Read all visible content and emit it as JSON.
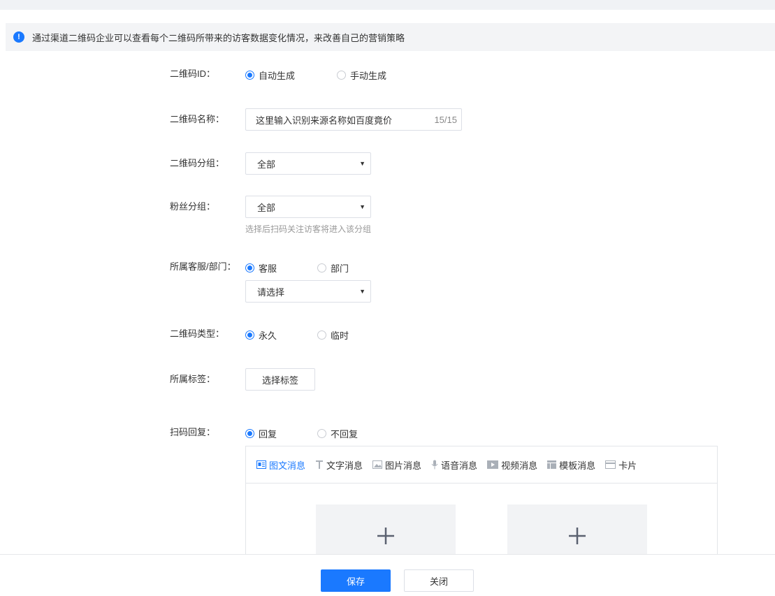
{
  "notice": {
    "text": "通过渠道二维码企业可以查看每个二维码所带来的访客数据变化情况，来改善自己的营销策略"
  },
  "form": {
    "qr_id": {
      "label": "二维码ID：",
      "options": [
        "自动生成",
        "手动生成"
      ],
      "selected": "自动生成"
    },
    "qr_name": {
      "label": "二维码名称：",
      "value": "这里输入识别来源名称如百度竟价",
      "counter": "15/15"
    },
    "qr_group": {
      "label": "二维码分组：",
      "value": "全部"
    },
    "fan_group": {
      "label": "粉丝分组：",
      "value": "全部",
      "hint": "选择后扫码关注访客将进入该分组"
    },
    "owner": {
      "label": "所属客服/部门：",
      "options": [
        "客服",
        "部门"
      ],
      "selected": "客服",
      "select_placeholder": "请选择"
    },
    "qr_type": {
      "label": "二维码类型：",
      "options": [
        "永久",
        "临时"
      ],
      "selected": "永久"
    },
    "tags": {
      "label": "所属标签：",
      "button": "选择标签"
    },
    "reply": {
      "label": "扫码回复：",
      "options": [
        "回复",
        "不回复"
      ],
      "selected": "回复",
      "tabs": [
        {
          "label": "图文消息",
          "icon": "news-icon"
        },
        {
          "label": "文字消息",
          "icon": "text-icon"
        },
        {
          "label": "图片消息",
          "icon": "image-icon"
        },
        {
          "label": "语音消息",
          "icon": "microphone-icon"
        },
        {
          "label": "视频消息",
          "icon": "video-icon"
        },
        {
          "label": "模板消息",
          "icon": "template-icon"
        },
        {
          "label": "卡片",
          "icon": "card-icon"
        }
      ],
      "active_tab": "图文消息",
      "add_symbol": "+"
    }
  },
  "footer": {
    "save": "保存",
    "close": "关闭"
  },
  "colors": {
    "accent": "#1a79ff",
    "border": "#dcdfe6",
    "panel_bg": "#f3f4f6"
  }
}
